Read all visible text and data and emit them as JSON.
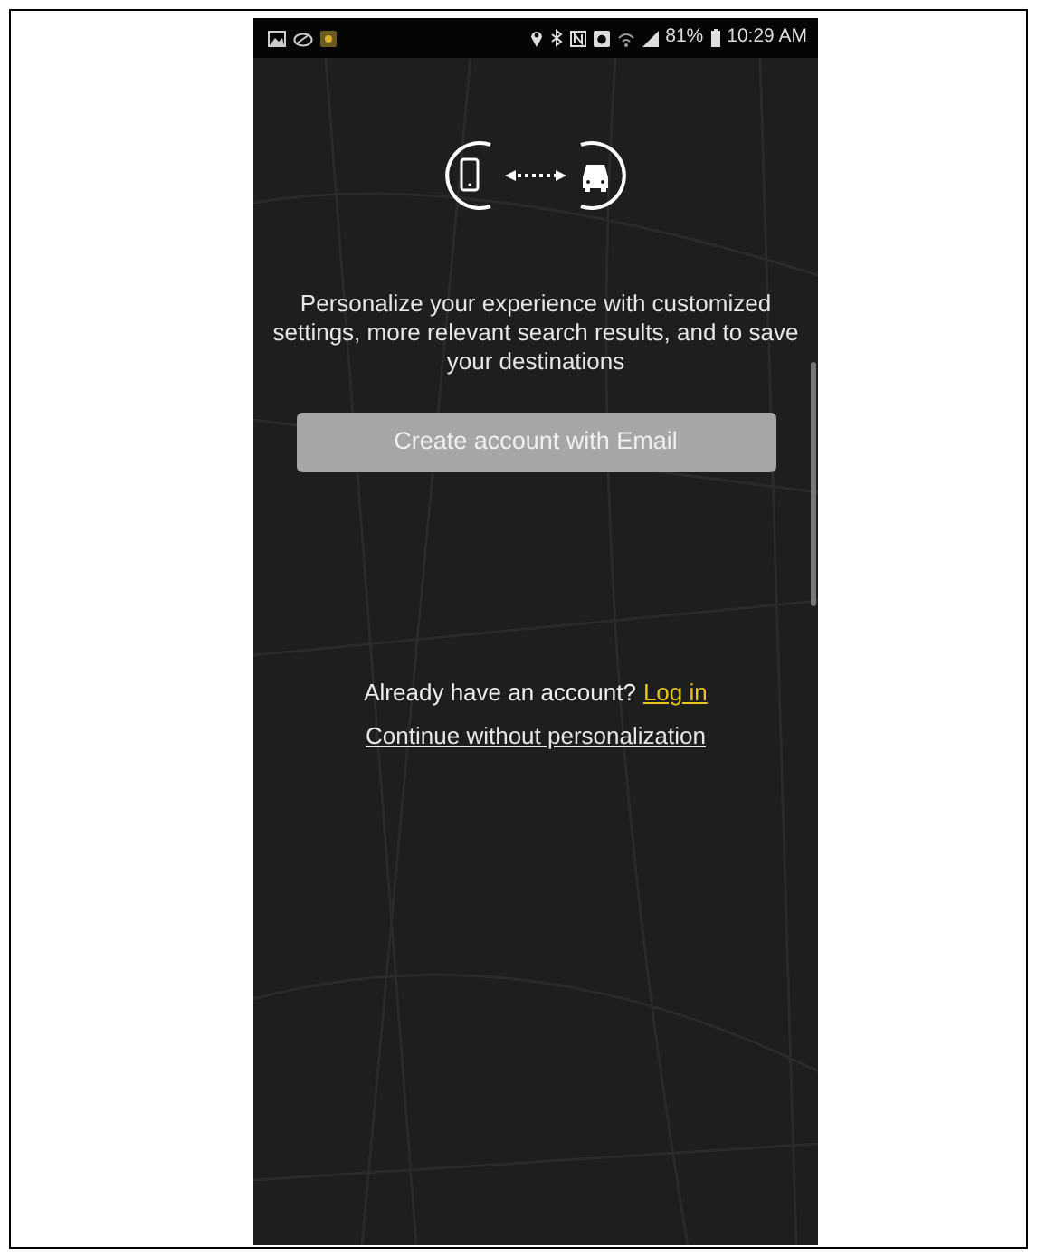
{
  "status_bar": {
    "battery": "81%",
    "time": "10:29 AM"
  },
  "message": "Personalize your experience with customized settings, more relevant search results, and to save your destinations",
  "create_button": {
    "label": "Create account with Email"
  },
  "login_prompt": {
    "text": "Already have an account?",
    "link": "Log in"
  },
  "skip_link": "Continue without personalization"
}
